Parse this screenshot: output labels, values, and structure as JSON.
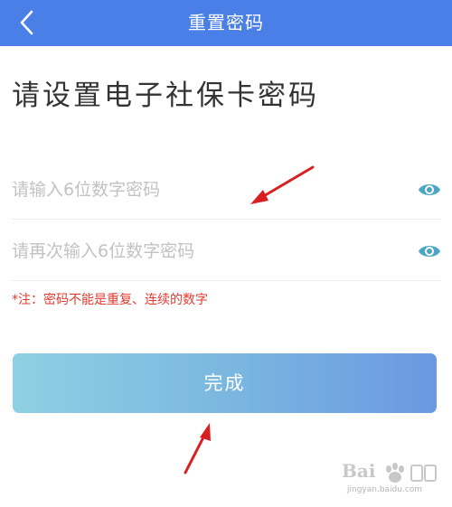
{
  "header": {
    "back_icon": "chevron-left-icon",
    "title": "重置密码",
    "background": "#4a7fe8"
  },
  "main": {
    "title": "请设置电子社保卡密码",
    "password_field": {
      "placeholder": "请输入6位数字密码",
      "value": "",
      "toggle_icon": "eye-icon"
    },
    "confirm_field": {
      "placeholder": "请再次输入6位数字密码",
      "value": "",
      "toggle_icon": "eye-icon"
    },
    "note": "*注：密码不能是重复、连续的数字",
    "note_color": "#e43a2f",
    "submit_label": "完成"
  },
  "annotations": {
    "arrow_color": "#d82020"
  },
  "watermark": {
    "logo_text": "Bai",
    "subtext": "jingyan.baidu.com"
  }
}
